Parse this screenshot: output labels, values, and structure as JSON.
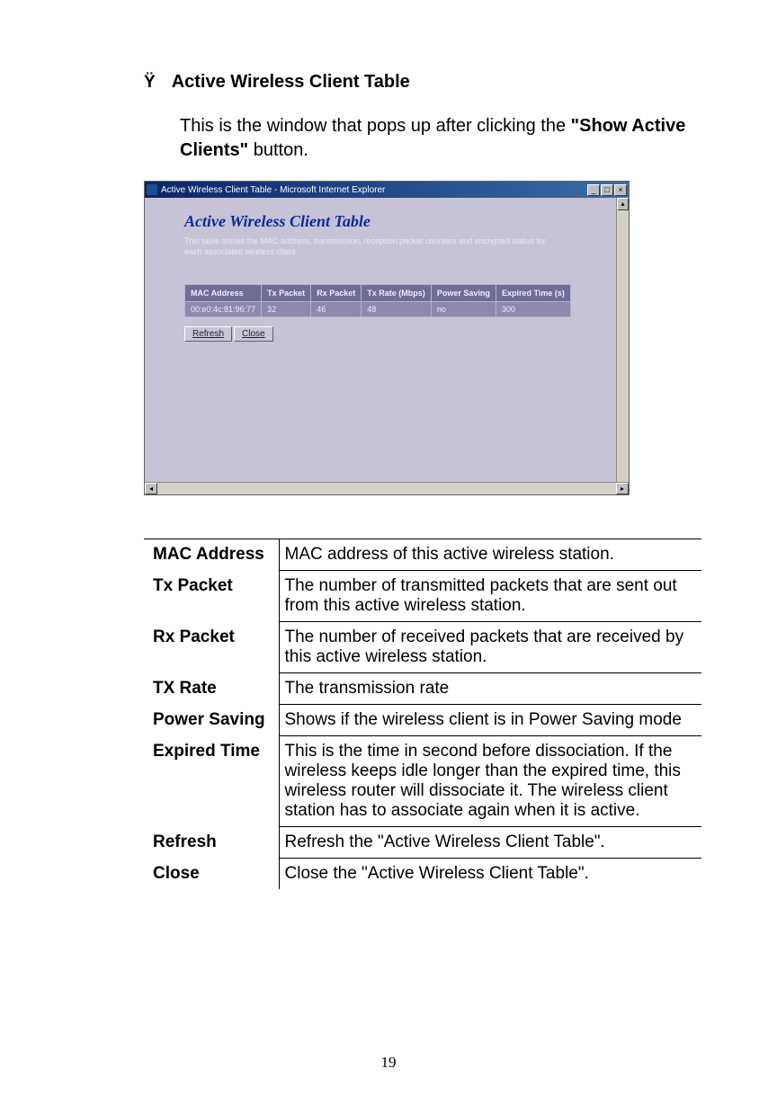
{
  "heading": {
    "bullet": "Ÿ",
    "text": "Active Wireless Client Table"
  },
  "intro": {
    "pre": "This is the window that pops up after clicking the ",
    "bold": "\"Show Active Clients\"",
    "post": " button."
  },
  "window": {
    "title": "Active Wireless Client Table - Microsoft Internet Explorer",
    "min": "_",
    "max": "□",
    "close": "×",
    "dialog_title": "Active Wireless Client Table",
    "dialog_desc": "This table shows the MAC address, transmission, reception packet counters and encrypted status for each associated wireless client.",
    "table_headers": [
      "MAC Address",
      "Tx Packet",
      "Rx Packet",
      "Tx Rate (Mbps)",
      "Power Saving",
      "Expired Time (s)"
    ],
    "table_row": [
      "00:e0:4c:81:96:77",
      "32",
      "46",
      "48",
      "no",
      "300"
    ],
    "btn_refresh": "Refresh",
    "btn_close": "Close"
  },
  "defs": [
    {
      "term": "MAC Address",
      "def": "MAC address of this active wireless station."
    },
    {
      "term": "Tx Packet",
      "def": "The number of transmitted packets that are sent out from this active wireless station."
    },
    {
      "term": "Rx Packet",
      "def": "The number of received packets that are received by this active wireless station."
    },
    {
      "term": "TX Rate",
      "def": "The transmission rate"
    },
    {
      "term": "Power Saving",
      "def": "Shows if the wireless client is in Power Saving mode"
    },
    {
      "term": "Expired Time",
      "def": "This is the time in second before dissociation. If the wireless keeps idle longer than the expired time, this wireless router will dissociate it. The wireless client station has to associate again when it is active."
    },
    {
      "term": "Refresh",
      "def": "Refresh the \"Active Wireless Client Table\"."
    },
    {
      "term": "Close",
      "def": "Close the \"Active Wireless Client Table\"."
    }
  ],
  "page_number": "19"
}
